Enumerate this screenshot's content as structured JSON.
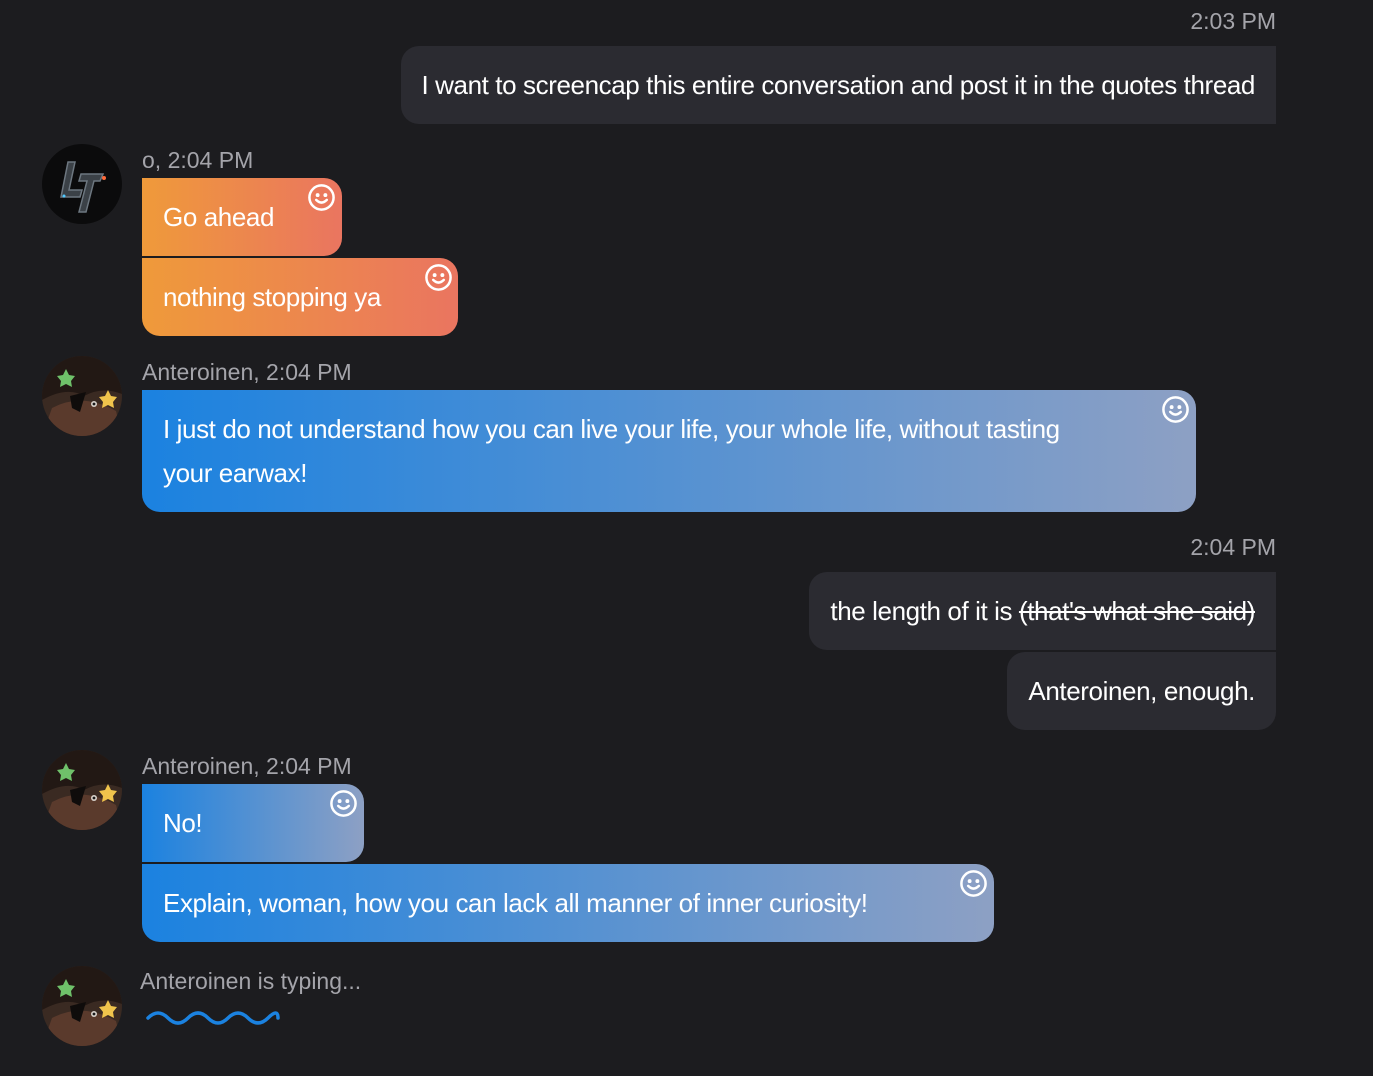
{
  "colors": {
    "background": "#1c1c1f",
    "own_bubble": "#2b2b31",
    "orange_start": "#ef9a3a",
    "orange_end": "#ea7560",
    "blue_start": "#1b82e0",
    "blue_end": "#8da0c4",
    "meta_text": "#a4a4aa"
  },
  "messages": {
    "m1": {
      "timestamp": "2:03 PM",
      "text": "I want to screencap this entire conversation and post it in the quotes thread"
    },
    "m2": {
      "meta": "o, 2:04 PM",
      "avatar_icon": "l7-logo-avatar",
      "lines": [
        "Go ahead",
        "nothing stopping ya"
      ]
    },
    "m3": {
      "meta": "Anteroinen, 2:04 PM",
      "avatar_icon": "dark-hair-avatar",
      "text": "I just do not understand how you can live your life, your whole life, without tasting your earwax!"
    },
    "m4": {
      "timestamp": "2:04 PM",
      "text_plain": "the length of it is ",
      "text_strike": "(that's what she said)",
      "text2": "Anteroinen, enough."
    },
    "m5": {
      "meta": "Anteroinen, 2:04 PM",
      "avatar_icon": "dark-hair-avatar",
      "lines": [
        "No!",
        "Explain, woman, how you can lack all manner of inner curiosity!"
      ]
    }
  },
  "typing": {
    "text": "Anteroinen is typing...",
    "icon": "typing-wave-icon"
  },
  "react_icon": "smiley-react-icon"
}
